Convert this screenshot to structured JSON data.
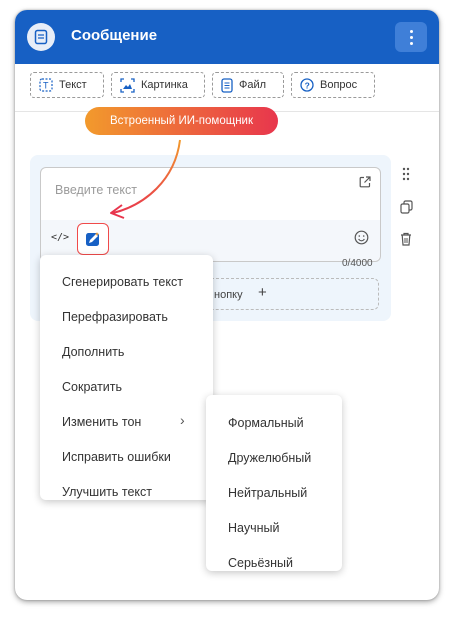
{
  "header": {
    "title": "Сообщение",
    "icon": "message-icon",
    "menu_icon": "kebab-menu-icon",
    "color": "#1760c4"
  },
  "content_types": [
    {
      "label": "Текст",
      "icon": "text-icon"
    },
    {
      "label": "Картинка",
      "icon": "image-icon"
    },
    {
      "label": "Файл",
      "icon": "file-icon"
    },
    {
      "label": "Вопрос",
      "icon": "question-icon"
    }
  ],
  "ai_badge": {
    "label": "Встроенный ИИ-помощник",
    "gradient": [
      "#f29a2c",
      "#e8364d"
    ]
  },
  "editor": {
    "placeholder": "Введите текст",
    "counter": "0/4000"
  },
  "add_button": {
    "label": "нопку"
  },
  "ai_menu": {
    "items": [
      "Сгенерировать текст",
      "Перефразировать",
      "Дополнить",
      "Сократить",
      "Изменить тон",
      "Исправить ошибки",
      "Улучшить текст"
    ]
  },
  "tone_submenu": {
    "items": [
      "Формальный",
      "Дружелюбный",
      "Нейтральный",
      "Научный",
      "Серьёзный"
    ]
  }
}
